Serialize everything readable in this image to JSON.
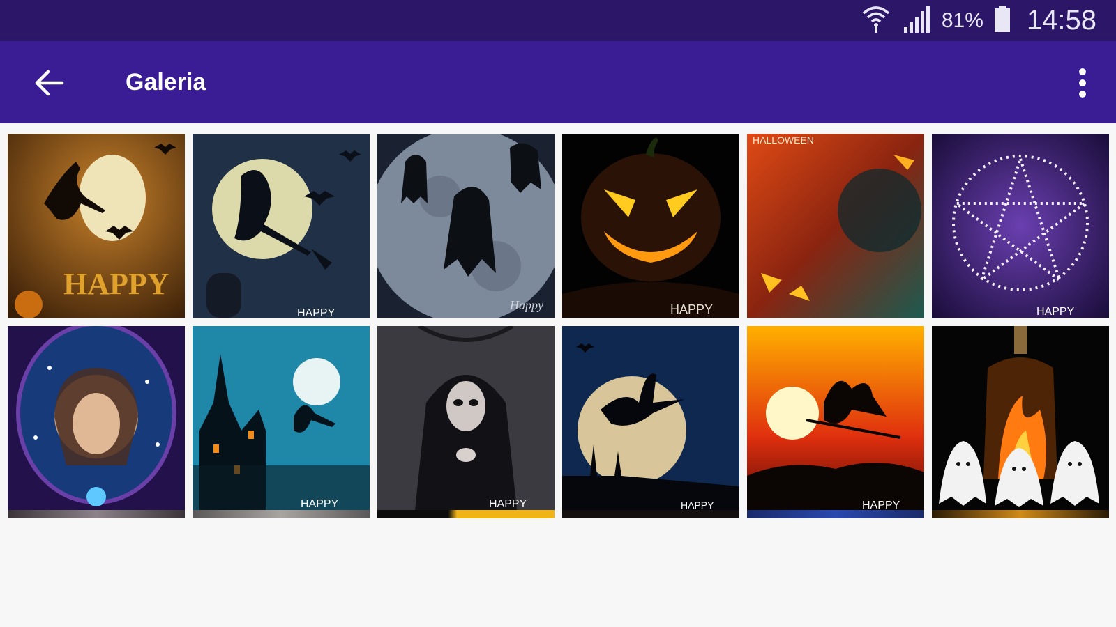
{
  "status_bar": {
    "battery_percent": "81%",
    "time": "14:58",
    "icons": [
      "wifi-icon",
      "signal-icon",
      "battery-icon"
    ]
  },
  "app_bar": {
    "title": "Galeria",
    "back_icon": "arrow-left-icon",
    "menu_icon": "more-vert-icon"
  },
  "gallery": {
    "row1": [
      {
        "name": "witch-moon-happy-halloween",
        "caption": "HAPPY"
      },
      {
        "name": "witch-broom-moon-bats",
        "caption": "HAPPY"
      },
      {
        "name": "ghosts-moon-silhouette",
        "caption": "Happy"
      },
      {
        "name": "jack-o-lantern",
        "caption": "HAPPY"
      },
      {
        "name": "fire-pumpkins-halloween",
        "caption": "HALLOWEEN"
      },
      {
        "name": "sparkle-pentagram",
        "caption": "HAPPY"
      }
    ],
    "row2": [
      {
        "name": "witch-crystal-ball-portrait",
        "caption": ""
      },
      {
        "name": "haunted-house-witch-moon",
        "caption": "HAPPY"
      },
      {
        "name": "gothic-lady-candle",
        "caption": "HAPPY"
      },
      {
        "name": "witch-moon-night-city",
        "caption": "HAPPY"
      },
      {
        "name": "witch-sunset-flight",
        "caption": "HAPPY"
      },
      {
        "name": "ghosts-fire-lantern",
        "caption": ""
      }
    ]
  },
  "colors": {
    "status_bar": "#2b1667",
    "app_bar": "#3a1d94",
    "background": "#f7f7f8"
  }
}
